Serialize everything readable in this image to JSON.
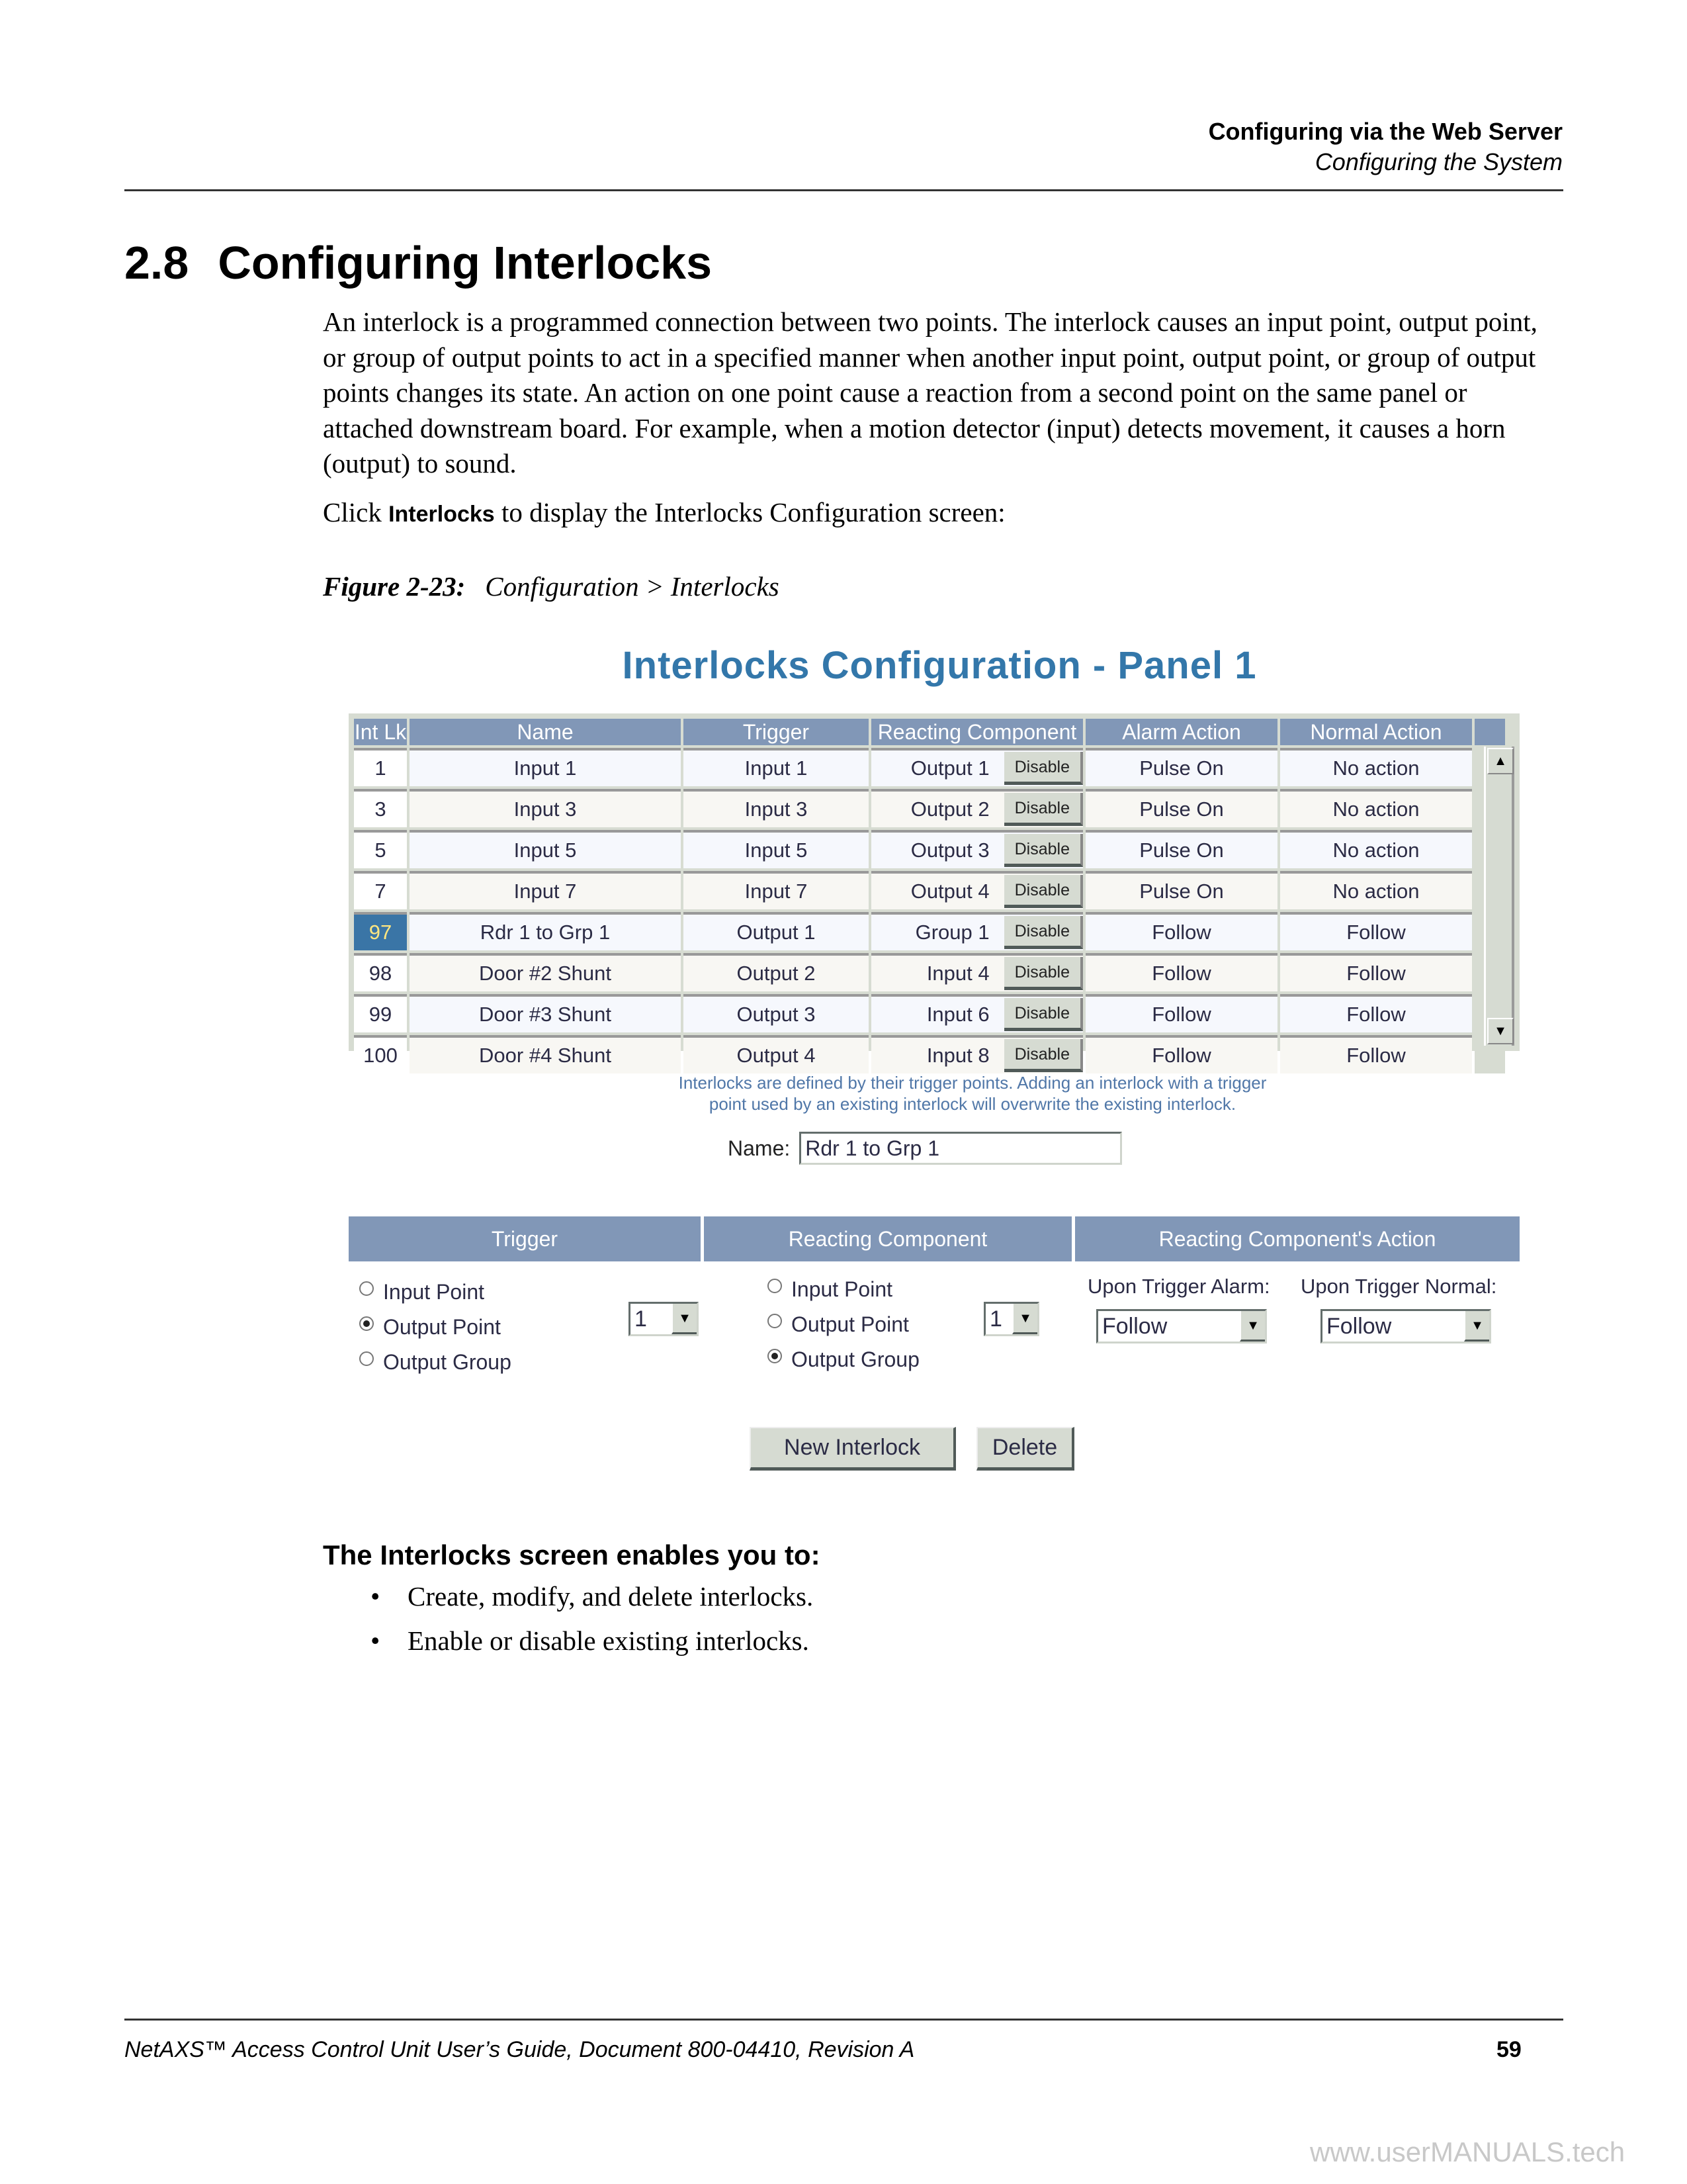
{
  "running_header": {
    "chapter": "Configuring via the Web Server",
    "section": "Configuring the System"
  },
  "section": {
    "number": "2.8",
    "title": "Configuring Interlocks"
  },
  "intro_paragraph": "An interlock is a programmed connection between two points. The interlock causes an input point, output point, or group of output points to act in a specified manner when another input point, output point, or group of output points changes its state. An action on one point cause a reaction from a second point on the same panel or attached downstream board. For example, when a motion detector (input) detects movement, it causes a horn (output) to sound.",
  "click_instruction": {
    "prefix": "Click ",
    "ui_word": "Interlocks",
    "suffix": " to display the Interlocks Configuration screen:"
  },
  "figure": {
    "label": "Figure 2-23:",
    "caption": "Configuration > Interlocks"
  },
  "screen": {
    "title": "Interlocks Configuration - Panel 1",
    "columns": [
      "Int Lk",
      "Name",
      "Trigger",
      "Reacting Component",
      "Alarm Action",
      "Normal Action"
    ],
    "rows": [
      {
        "id": "1",
        "name": "Input 1",
        "trigger": "Input 1",
        "reacting": "Output 1",
        "button": "Disable",
        "alarm": "Pulse On",
        "normal": "No action",
        "selected": false
      },
      {
        "id": "3",
        "name": "Input 3",
        "trigger": "Input 3",
        "reacting": "Output 2",
        "button": "Disable",
        "alarm": "Pulse On",
        "normal": "No action",
        "selected": false
      },
      {
        "id": "5",
        "name": "Input 5",
        "trigger": "Input 5",
        "reacting": "Output 3",
        "button": "Disable",
        "alarm": "Pulse On",
        "normal": "No action",
        "selected": false
      },
      {
        "id": "7",
        "name": "Input 7",
        "trigger": "Input 7",
        "reacting": "Output 4",
        "button": "Disable",
        "alarm": "Pulse On",
        "normal": "No action",
        "selected": false
      },
      {
        "id": "97",
        "name": "Rdr 1 to Grp 1",
        "trigger": "Output 1",
        "reacting": "Group 1",
        "button": "Disable",
        "alarm": "Follow",
        "normal": "Follow",
        "selected": true
      },
      {
        "id": "98",
        "name": "Door #2 Shunt",
        "trigger": "Output 2",
        "reacting": "Input 4",
        "button": "Disable",
        "alarm": "Follow",
        "normal": "Follow",
        "selected": false
      },
      {
        "id": "99",
        "name": "Door #3 Shunt",
        "trigger": "Output 3",
        "reacting": "Input 6",
        "button": "Disable",
        "alarm": "Follow",
        "normal": "Follow",
        "selected": false
      },
      {
        "id": "100",
        "name": "Door #4 Shunt",
        "trigger": "Output 4",
        "reacting": "Input 8",
        "button": "Disable",
        "alarm": "Follow",
        "normal": "Follow",
        "selected": false
      }
    ],
    "scroll_up_icon": "▲",
    "scroll_down_icon": "▼",
    "hint_line1": "Interlocks are defined by their trigger points. Adding an interlock with a trigger",
    "hint_line2": "point used by an existing interlock will overwrite the existing interlock.",
    "name_label": "Name:",
    "name_value": "Rdr 1 to Grp 1",
    "form_headers": [
      "Trigger",
      "Reacting Component",
      "Reacting Component's Action"
    ],
    "trigger_options": [
      {
        "label": "Input Point",
        "checked": false
      },
      {
        "label": "Output Point",
        "checked": true
      },
      {
        "label": "Output Group",
        "checked": false
      }
    ],
    "trigger_select": "1",
    "reacting_options": [
      {
        "label": "Input Point",
        "checked": false
      },
      {
        "label": "Output Point",
        "checked": false
      },
      {
        "label": "Output Group",
        "checked": true
      }
    ],
    "reacting_select": "1",
    "alarm_label": "Upon Trigger Alarm:",
    "alarm_select": "Follow",
    "normal_label": "Upon Trigger Normal:",
    "normal_select": "Follow",
    "dropdown_icon": "▼",
    "new_button": "New Interlock",
    "delete_button": "Delete",
    "colors": {
      "title": "#3377aa",
      "header_bg": "#8197b7",
      "selected_cell": "#3a75a6",
      "button_bg": "#d6dbd2"
    }
  },
  "enables": {
    "heading": "The Interlocks screen enables you to:",
    "bullet_symbol": "•",
    "items": [
      "Create, modify, and delete interlocks.",
      "Enable or disable existing interlocks."
    ]
  },
  "footer": {
    "text": "NetAXS™ Access Control Unit User’s Guide, Document 800-04410, Revision A",
    "page": "59"
  },
  "watermark": "www.userMANUALS.tech"
}
